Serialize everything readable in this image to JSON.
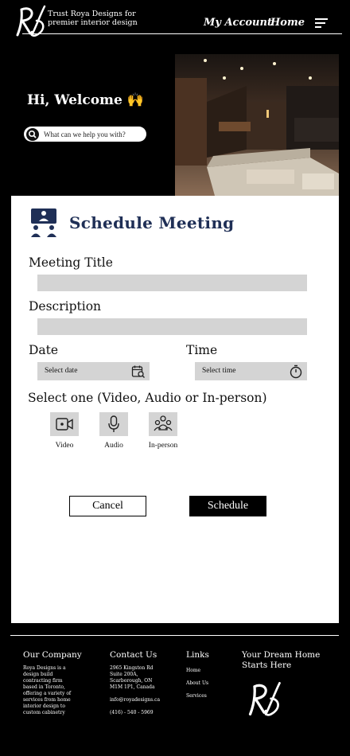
{
  "header": {
    "tagline": "Trust Roya Designs for premier interior design",
    "nav_account": "My Account",
    "nav_home": "Home"
  },
  "hero": {
    "welcome": "Hi, Welcome 🙌",
    "search_placeholder": "What can we help you with?"
  },
  "form": {
    "title": "Schedule Meeting",
    "meeting_title_label": "Meeting Title",
    "description_label": "Description",
    "date_label": "Date",
    "date_placeholder": "Select date",
    "time_label": "Time",
    "time_placeholder": "Select time",
    "select_label": "Select one (Video, Audio or In-person)",
    "options": [
      {
        "label": "Video",
        "icon": "video-icon"
      },
      {
        "label": "Audio",
        "icon": "microphone-icon"
      },
      {
        "label": "In-person",
        "icon": "people-icon"
      }
    ],
    "cancel": "Cancel",
    "schedule": "Schedule",
    "accent_color": "#1f2f56"
  },
  "footer": {
    "company_title": "Our Company",
    "company_text": [
      "Roya Designs is a",
      "design build",
      "contracting firm",
      "based in Toronto,",
      "offering a variety of",
      "services from home",
      "interior design to",
      "custom cabinetry"
    ],
    "contact_title": "Contact Us",
    "contact_address": [
      "2965 Kingston Rd",
      "Suite 200A,",
      "Scarborough, ON",
      "M1M 1P1, Canada"
    ],
    "contact_email": "info@royadesigns.ca",
    "contact_phone": "(416) - 540 - 5969",
    "links_title": "Links",
    "links": [
      "Home",
      "About Us",
      "Services"
    ],
    "dream_title": "Your Dream Home Starts Here"
  }
}
